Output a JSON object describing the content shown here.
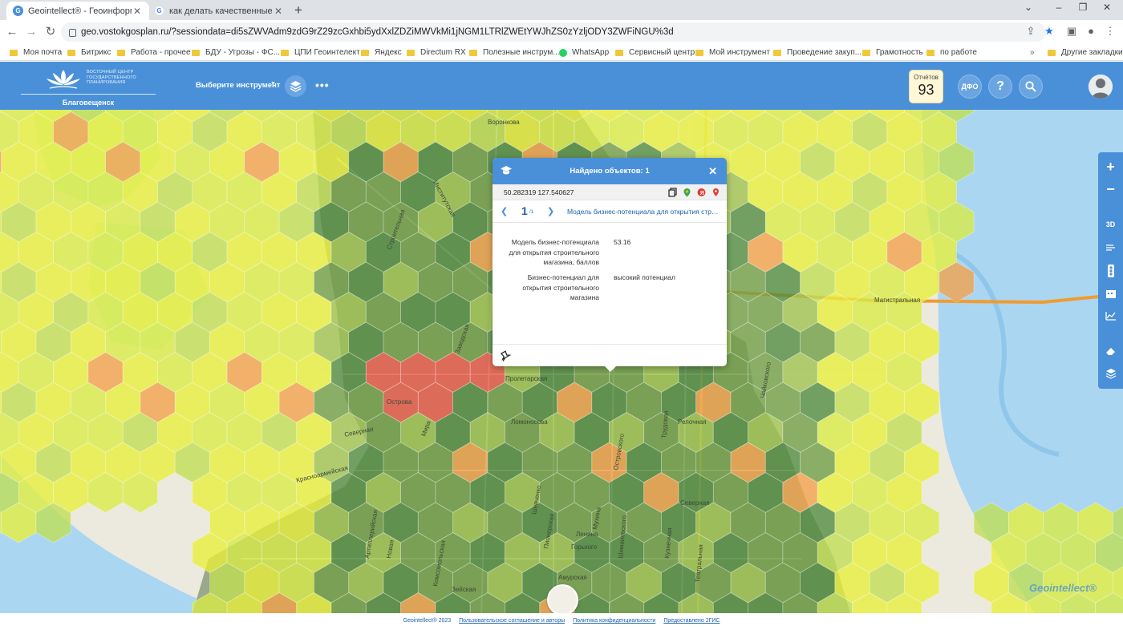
{
  "browser": {
    "tabs": [
      {
        "title": "Geointellect® - Геоинформацио",
        "active": true
      },
      {
        "title": "как делать качественные снимк",
        "active": false
      }
    ],
    "url": "geo.vostokgosplan.ru/?sessiondata=di5sZWVAdm9zdG9rZ29zcGxhbi5ydXxlZDZiMWVkMi1jNGM1LTRlZWEtYWJhZS0zYzljODY3ZWFiNGU%3d",
    "bookmarks": [
      "Моя почта",
      "Битрикс",
      "Работа - прочее",
      "БДУ - Угрозы - ФС...",
      "ЦПИ Геоинтелект",
      "Яндекс",
      "Directum RX",
      "Полезные инструм...",
      "WhatsApp",
      "Сервисный центр",
      "Мой инструмент",
      "Проведение закуп...",
      "Грамотность",
      "по работе",
      "Другие закладки"
    ]
  },
  "app": {
    "logo_text": "ВОСТОЧНЫЙ ЦЕНТР ГОСУДАРСТВЕННОГО ПЛАНИРОВАНИЯ",
    "city": "Благовещенск",
    "tool_select": "Выберите инструмент",
    "reports_label": "Отчётов",
    "reports_count": "93",
    "dfo_label": "ДФО",
    "help_label": "?",
    "accent": "#4a90d9"
  },
  "map_tools": [
    "+",
    "−",
    "3D"
  ],
  "popup": {
    "title": "Найдено объектов: 1",
    "coordinates": "50.282319 127.540627",
    "page": "1",
    "page_total": "/1",
    "layer": "Модель бизнес-потенциала для открытия строительного магазина",
    "attributes": [
      {
        "key": "Модель бизнес-потенциала для открытия строительного магазина, баллов",
        "value": "53.16"
      },
      {
        "key": "Бизнес-потенциал для открытия строительного магазина",
        "value": "высокий потенциал"
      }
    ]
  },
  "map_labels": [
    "Воронкова",
    "Институтская",
    "Строительная",
    "Заводская",
    "Пролетарская",
    "Ломоносова",
    "Красноармейская",
    "Артиллерийская",
    "Новая",
    "Комсомольская",
    "Зейская",
    "Амурская",
    "Шевченко",
    "Пионерская",
    "Мухина",
    "Ленина",
    "Горького",
    "Мира",
    "Северная",
    "Шимановского",
    "Кузнечная",
    "Театральная",
    "Чайковского",
    "Островского",
    "Трудовая",
    "Магистральная",
    "Северная",
    "Острова",
    "Релочная"
  ],
  "watermark": "Geointellect®",
  "footer": {
    "copyright": "Geointellect® 2023",
    "links": [
      "Пользовательское соглашение и авторы",
      "Политика конфиденциальности",
      "Предоставлено 2ГИС"
    ]
  }
}
